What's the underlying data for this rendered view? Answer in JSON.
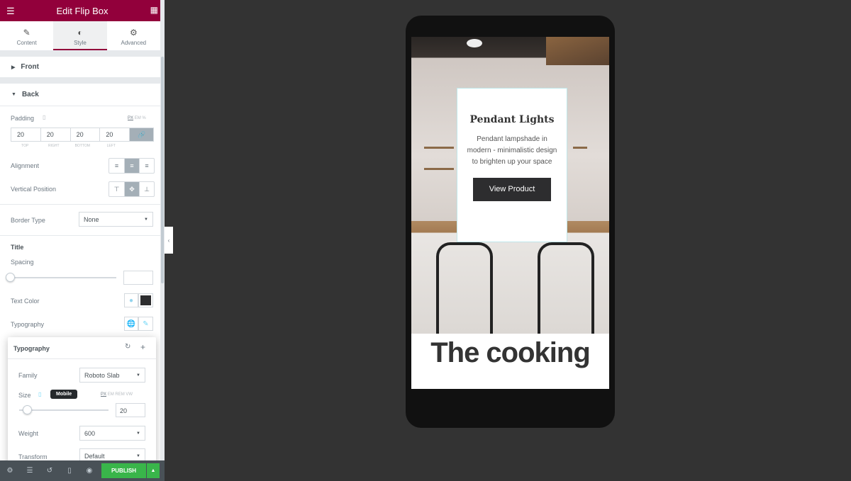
{
  "header": {
    "title": "Edit Flip Box",
    "menu_icon": "hamburger-icon",
    "apps_icon": "grid-icon"
  },
  "tabs": [
    {
      "label": "Content",
      "icon": "pencil-icon"
    },
    {
      "label": "Style",
      "icon": "half-circle-icon",
      "active": true
    },
    {
      "label": "Advanced",
      "icon": "gear-icon"
    }
  ],
  "sections": {
    "front": "Front",
    "back": "Back"
  },
  "padding": {
    "label": "Padding",
    "units": [
      "PX",
      "EM",
      "%"
    ],
    "values": [
      "20",
      "20",
      "20",
      "20"
    ],
    "sides": [
      "TOP",
      "RIGHT",
      "BOTTOM",
      "LEFT"
    ]
  },
  "alignment": {
    "label": "Alignment",
    "selected": "center"
  },
  "vertical_position": {
    "label": "Vertical Position",
    "selected": "middle"
  },
  "border_type": {
    "label": "Border Type",
    "value": "None"
  },
  "title_section": {
    "heading": "Title",
    "spacing_label": "Spacing",
    "spacing_value": "",
    "text_color_label": "Text Color",
    "text_color": "#2d2d2f",
    "typography_label": "Typography"
  },
  "typography_popover": {
    "title": "Typography",
    "family_label": "Family",
    "family": "Roboto Slab",
    "size_label": "Size",
    "tooltip": "Mobile",
    "size_units": [
      "PX",
      "EM",
      "REM",
      "VW"
    ],
    "size": "20",
    "weight_label": "Weight",
    "weight": "600",
    "transform_label": "Transform",
    "transform": "Default"
  },
  "footer": {
    "publish": "PUBLISH",
    "icons": [
      "settings-icon",
      "layers-icon",
      "history-icon",
      "responsive-icon",
      "preview-icon"
    ]
  },
  "preview": {
    "card_title": "Pendant Lights",
    "card_text": "Pendant lampshade in modern - minimalistic design to brighten up your space",
    "button": "View Product",
    "heading": "The cooking"
  },
  "colors": {
    "brand": "#92003b",
    "publish": "#39b54a",
    "canvas": "#333333"
  }
}
